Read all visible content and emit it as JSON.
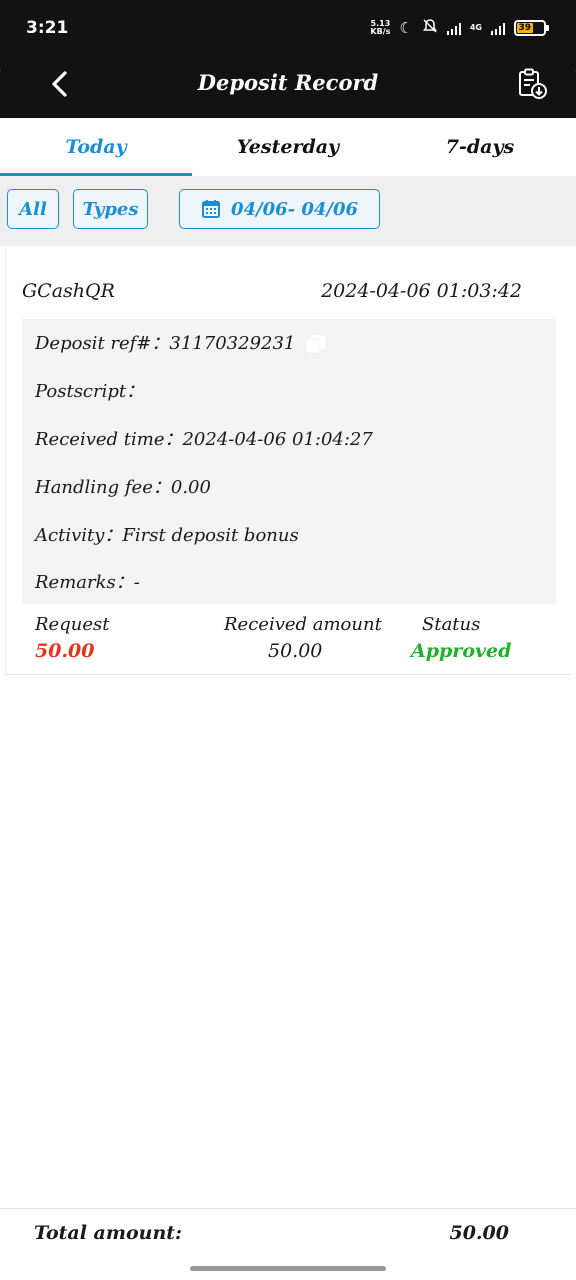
{
  "status_bar": {
    "time": "3:21",
    "net_speed_value": "5.13",
    "net_speed_unit": "KB/s",
    "network_label": "4G",
    "battery": "39"
  },
  "header": {
    "title": "Deposit Record",
    "icons": [
      "back-arrow-icon",
      "clipboard-download-icon"
    ]
  },
  "tabs": [
    {
      "label": "Today",
      "active": true
    },
    {
      "label": "Yesterday",
      "active": false
    },
    {
      "label": "7-days",
      "active": false
    }
  ],
  "filters": {
    "all_label": "All",
    "types_label": "Types",
    "date_range": "04/06- 04/06",
    "date_icon": "calendar-icon"
  },
  "record": {
    "method": "GCashQR",
    "datetime": "2024-04-06 01:03:42",
    "details": {
      "deposit_ref_label": "Deposit ref#：",
      "deposit_ref_value": "31170329231",
      "postscript_label": "Postscript：",
      "postscript_value": "",
      "received_time_label": "Received time：",
      "received_time_value": "2024-04-06 01:04:27",
      "handling_fee_label": "Handling fee：",
      "handling_fee_value": "0.00",
      "activity_label": "Activity：",
      "activity_value": "First deposit bonus",
      "remarks_label": "Remarks：",
      "remarks_value": "-"
    },
    "summary": {
      "request_label": "Request",
      "request_value": "50.00",
      "received_label": "Received amount",
      "received_value": "50.00",
      "status_label": "Status",
      "status_value": "Approved"
    }
  },
  "footer": {
    "total_label": "Total amount:",
    "total_value": "50.00"
  },
  "colors": {
    "accent": "#1a8fd6",
    "header_bg": "#121212",
    "request_red": "#e8331c",
    "approved_green": "#20b12a"
  }
}
